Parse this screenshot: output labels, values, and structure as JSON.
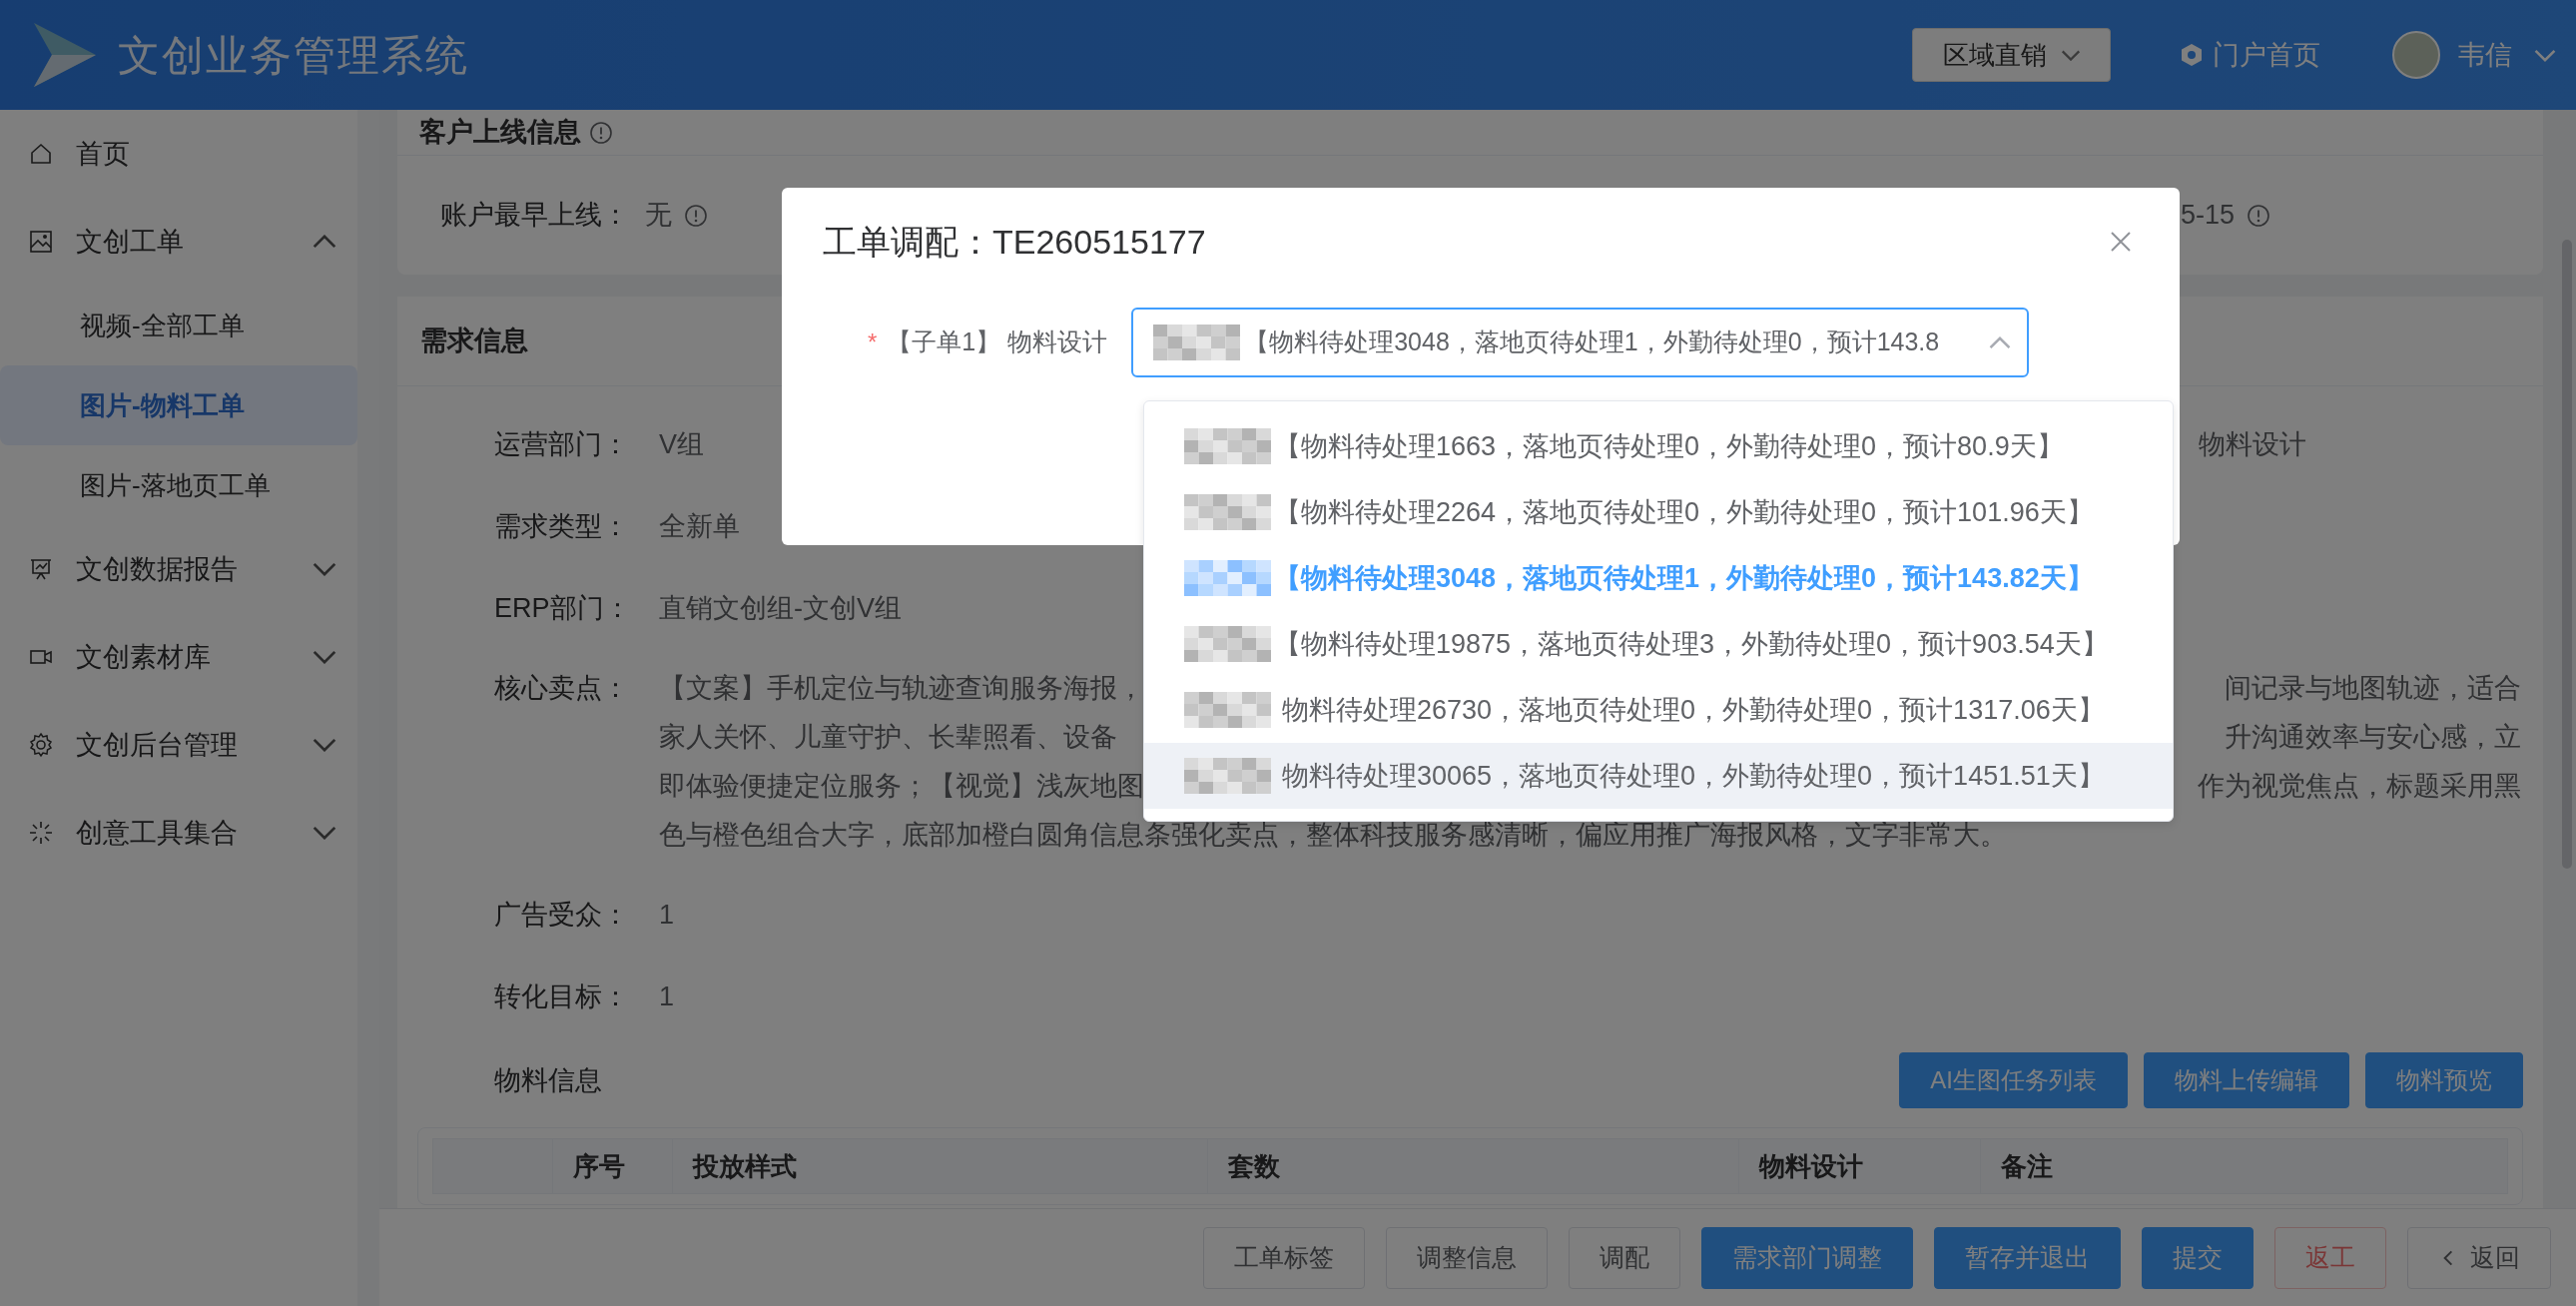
{
  "header": {
    "title": "文创业务管理系统",
    "region_button": "区域直销",
    "portal_link": "门户首页",
    "user_name": "韦信"
  },
  "sidebar": {
    "items": [
      {
        "label": "首页",
        "selected": false
      },
      {
        "label": "文创工单",
        "selected": false,
        "expanded": true,
        "children": [
          {
            "label": "视频-全部工单",
            "selected": false
          },
          {
            "label": "图片-物料工单",
            "selected": true
          },
          {
            "label": "图片-落地页工单",
            "selected": false
          }
        ]
      },
      {
        "label": "文创数据报告",
        "selected": false,
        "expanded": false
      },
      {
        "label": "文创素材库",
        "selected": false,
        "expanded": false
      },
      {
        "label": "文创后台管理",
        "selected": false,
        "expanded": false
      },
      {
        "label": "创意工具集合",
        "selected": false,
        "expanded": false
      }
    ]
  },
  "account_card": {
    "title": "客户上线信息",
    "field": {
      "label": "账户最早上线：",
      "value": "无"
    },
    "right_value": "5-15"
  },
  "requirement_card": {
    "title": "需求信息",
    "fields": [
      {
        "kind": "text",
        "label": "运营部门：",
        "value": "V组",
        "right_value": "物料设计"
      },
      {
        "kind": "text",
        "label": "需求类型：",
        "value": "全新单"
      },
      {
        "kind": "text",
        "label": "ERP部门：",
        "value": "直销文创组-文创V组"
      },
      {
        "kind": "lines",
        "label": "核心卖点：",
        "lines": [
          {
            "left": "【文案】手机定位与轨迹查询服务海报，",
            "right": "间记录与地图轨迹，适合"
          },
          {
            "left": "家人关怀、儿童守护、长辈照看、设备",
            "right": "升沟通效率与安心感，立"
          },
          {
            "left": "即体验便捷定位服务；【视觉】浅灰地图",
            "right": "作为视觉焦点，标题采用黑"
          },
          {
            "left": "色与橙色组合大字，底部加橙白圆角信息条强化卖点，整体科技服务感清晰，偏应用推广海报风格，文字非常大。"
          }
        ]
      },
      {
        "kind": "text",
        "label": "广告受众：",
        "value": "1"
      },
      {
        "kind": "text",
        "label": "转化目标：",
        "value": "1"
      }
    ]
  },
  "material_section": {
    "title": "物料信息",
    "buttons": [
      "AI生图任务列表",
      "物料上传编辑",
      "物料预览"
    ],
    "table": {
      "columns": [
        "序号",
        "投放样式",
        "套数",
        "物料设计",
        "备注"
      ]
    }
  },
  "footer_buttons": [
    {
      "label": "工单标签",
      "kind": "default"
    },
    {
      "label": "调整信息",
      "kind": "default"
    },
    {
      "label": "调配",
      "kind": "default"
    },
    {
      "label": "需求部门调整",
      "kind": "primary"
    },
    {
      "label": "暂存并退出",
      "kind": "primary"
    },
    {
      "label": "提交",
      "kind": "primary"
    },
    {
      "label": "返工",
      "kind": "danger"
    },
    {
      "label": "返回",
      "kind": "back"
    }
  ],
  "modal": {
    "title": "工单调配：TE260515177",
    "field": {
      "required_mark": "*",
      "label": "【子单1】 物料设计",
      "value": "【物料待处理3048，落地页待处理1，外勤待处理0，预计143.8",
      "open": true
    },
    "options": [
      {
        "text": "【物料待处理1663，落地页待处理0，外勤待处理0，预计80.9天】",
        "selected": false,
        "hovered": false
      },
      {
        "text": "【物料待处理2264，落地页待处理0，外勤待处理0，预计101.96天】",
        "selected": false,
        "hovered": false
      },
      {
        "text": "【物料待处理3048，落地页待处理1，外勤待处理0，预计143.82天】",
        "selected": true,
        "hovered": false
      },
      {
        "text": "【物料待处理19875，落地页待处理3，外勤待处理0，预计903.54天】",
        "selected": false,
        "hovered": false
      },
      {
        "text": "物料待处理26730，落地页待处理0，外勤待处理0，预计1317.06天】",
        "selected": false,
        "hovered": false
      },
      {
        "text": "物料待处理30065，落地页待处理0，外勤待处理0，预计1451.51天】",
        "selected": false,
        "hovered": true
      }
    ]
  }
}
